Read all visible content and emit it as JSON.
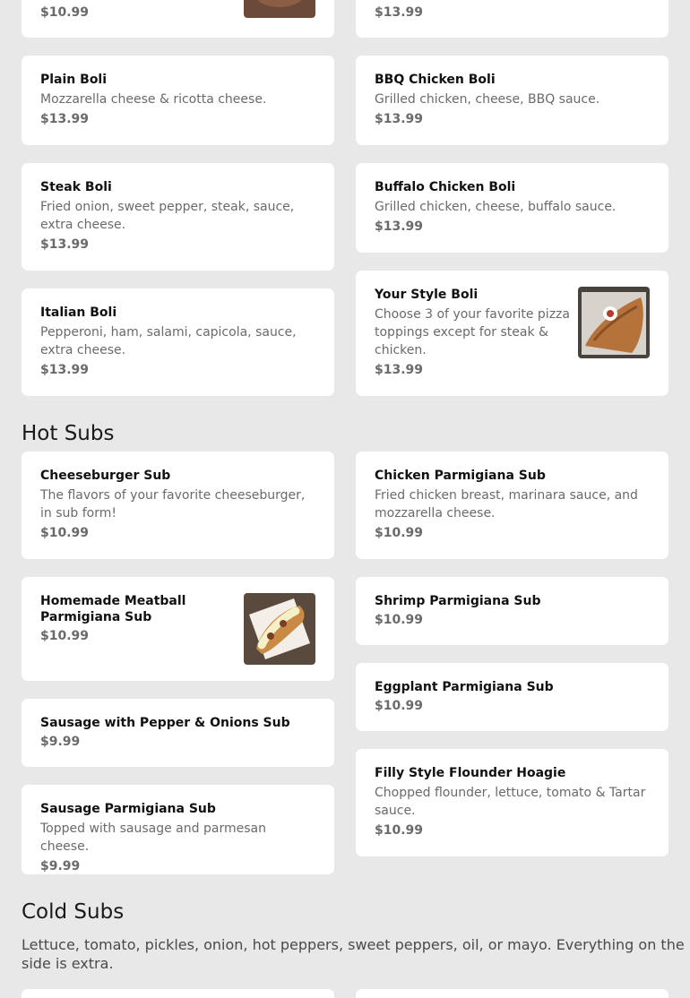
{
  "top_partial": {
    "left_price": "$10.99",
    "right_price": "$13.99"
  },
  "boli": [
    {
      "name": "Plain Boli",
      "desc": "Mozzarella cheese & ricotta cheese.",
      "price": "$13.99"
    },
    {
      "name": "BBQ Chicken Boli",
      "desc": "Grilled chicken, cheese, BBQ sauce.",
      "price": "$13.99"
    },
    {
      "name": "Steak Boli",
      "desc": "Fried onion, sweet pepper, steak, sauce, extra cheese.",
      "price": "$13.99"
    },
    {
      "name": "Buffalo Chicken Boli",
      "desc": "Grilled chicken, cheese, buffalo sauce.",
      "price": "$13.99"
    },
    {
      "name": "Italian Boli",
      "desc": "Pepperoni, ham, salami, capicola, sauce, extra cheese.",
      "price": "$13.99"
    },
    {
      "name": "Your Style Boli",
      "desc": "Choose 3 of your favorite pizza toppings except for steak & chicken.",
      "price": "$13.99"
    }
  ],
  "hot_subs": {
    "title": "Hot Subs",
    "items": [
      {
        "name": "Cheeseburger Sub",
        "desc": "The flavors of your favorite cheeseburger, in sub form!",
        "price": "$10.99"
      },
      {
        "name": "Chicken Parmigiana Sub",
        "desc": "Fried chicken breast, marinara sauce, and mozzarella cheese.",
        "price": "$10.99"
      },
      {
        "name": "Homemade Meatball Parmigiana Sub",
        "price": "$10.99"
      },
      {
        "name": "Shrimp Parmigiana Sub",
        "price": "$10.99"
      },
      {
        "name": "Eggplant Parmigiana Sub",
        "price": "$10.99"
      },
      {
        "name": "Sausage with Pepper & Onions Sub",
        "price": "$9.99"
      },
      {
        "name": "Filly Style Flounder Hoagie",
        "desc": "Chopped flounder, lettuce, tomato & Tartar sauce.",
        "price": "$10.99"
      },
      {
        "name": "Sausage Parmigiana Sub",
        "desc": "Topped with sausage and parmesan cheese.",
        "price": "$9.99"
      }
    ]
  },
  "cold_subs": {
    "title": "Cold Subs",
    "note": "Lettuce, tomato, pickles, onion, hot peppers, sweet peppers, oil, or mayo. Everything on the side is extra."
  }
}
